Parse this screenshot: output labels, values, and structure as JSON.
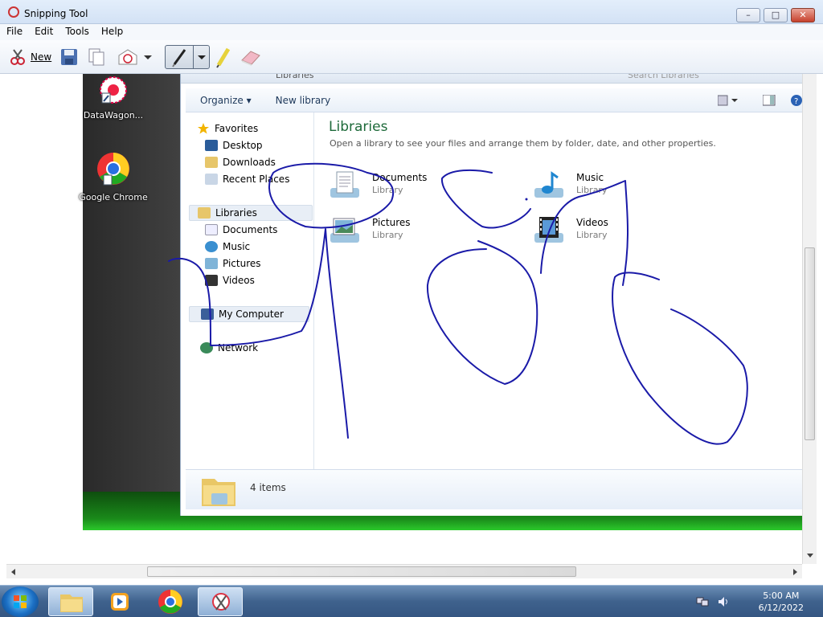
{
  "window": {
    "title": "Snipping Tool",
    "controls": {
      "minimize": "–",
      "maximize": "□",
      "close": "✕"
    }
  },
  "menu": {
    "items": [
      "File",
      "Edit",
      "Tools",
      "Help"
    ]
  },
  "toolbar": {
    "new_label": "New"
  },
  "desktop": {
    "icons": [
      {
        "label": "DataWagon...",
        "icon": "datawagon-icon"
      },
      {
        "label": "Google Chrome",
        "icon": "chrome-icon"
      }
    ]
  },
  "explorer": {
    "address": "Libraries",
    "search_placeholder": "Search Libraries",
    "commands": {
      "organize": "Organize ▾",
      "new_library": "New library"
    },
    "nav": {
      "favorites": "Favorites",
      "favorites_items": [
        "Desktop",
        "Downloads",
        "Recent Places"
      ],
      "libraries": "Libraries",
      "libraries_items": [
        "Documents",
        "Music",
        "Pictures",
        "Videos"
      ],
      "computer": "My Computer",
      "network": "Network"
    },
    "content": {
      "title": "Libraries",
      "subtitle": "Open a library to see your files and arrange them by folder, date, and other properties.",
      "libraries": [
        {
          "name": "Documents",
          "type": "Library"
        },
        {
          "name": "Music",
          "type": "Library"
        },
        {
          "name": "Pictures",
          "type": "Library"
        },
        {
          "name": "Videos",
          "type": "Library"
        }
      ]
    },
    "details": {
      "count": "4 items"
    }
  },
  "taskbar": {
    "time": "5:00 AM",
    "date": "6/12/2022"
  },
  "colors": {
    "ink": "#1a1aa8",
    "accent": "#1e6a3a"
  }
}
